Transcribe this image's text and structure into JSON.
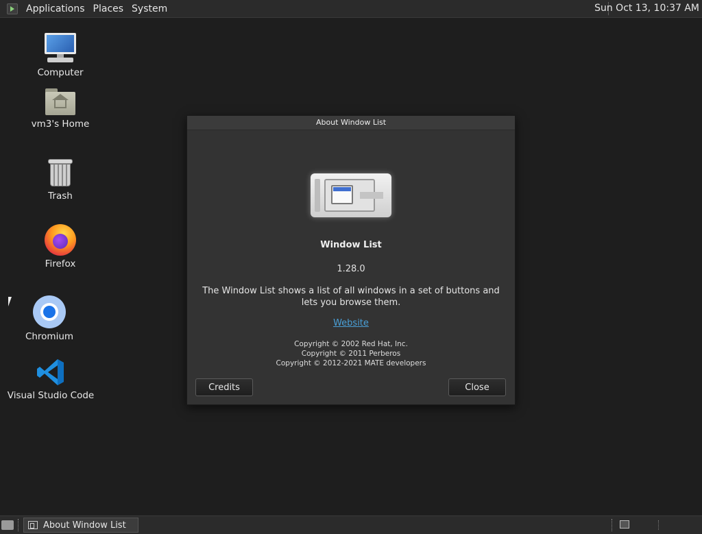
{
  "top_panel": {
    "menus": [
      "Applications",
      "Places",
      "System"
    ],
    "clock": "Sun Oct 13, 10:37 AM"
  },
  "desktop": {
    "icons": [
      {
        "label": "Computer",
        "icon": "computer-icon"
      },
      {
        "label": "vm3's Home",
        "icon": "home-folder-icon"
      },
      {
        "label": "Trash",
        "icon": "trash-icon"
      },
      {
        "label": "Firefox",
        "icon": "firefox-icon"
      },
      {
        "label": "Chromium",
        "icon": "chromium-icon"
      },
      {
        "label": "Visual Studio Code",
        "icon": "vscode-icon"
      }
    ]
  },
  "dialog": {
    "title": "About Window List",
    "name": "Window List",
    "version": "1.28.0",
    "description": "The Window List shows a list of all windows in a set of buttons and lets you browse them.",
    "website": "Website",
    "copyright": [
      "Copyright © 2002 Red Hat, Inc.",
      "Copyright © 2011 Perberos",
      "Copyright © 2012-2021 MATE developers"
    ],
    "credits_label": "Credits",
    "close_label": "Close"
  },
  "bottom_panel": {
    "task": "About Window List"
  }
}
